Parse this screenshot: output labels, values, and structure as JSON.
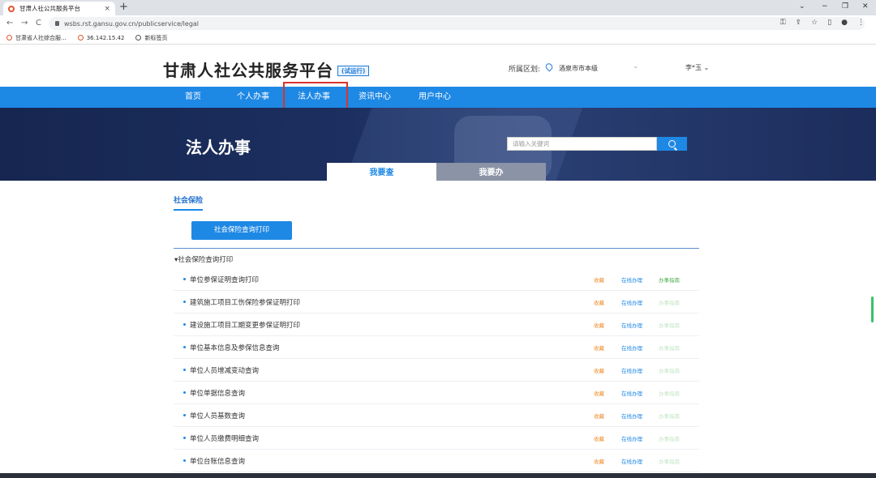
{
  "browser": {
    "tab_title": "甘肃人社公共服务平台",
    "tab_close": "×",
    "new_tab": "+",
    "window_controls": [
      "⌄",
      "−",
      "❐",
      "✕"
    ],
    "url": "wsbs.rst.gansu.gov.cn/publicservice/legal",
    "back": "←",
    "forward": "→",
    "reload": "C",
    "omni_icons": [
      "⚿",
      "⇪",
      "☆",
      "▯",
      "●",
      "⋮"
    ],
    "bookmarks": [
      "甘肃省人社综合服...",
      "36.142.15.42",
      "新标签页"
    ]
  },
  "header": {
    "title": "甘肃人社公共服务平台",
    "trial_badge": "(试运行)",
    "region_label": "所属区划:",
    "region_value": "酒泉市市本级",
    "region_arrow": "⌄",
    "user_name": "李*玉 ⌄"
  },
  "nav": {
    "items": [
      "首页",
      "个人办事",
      "法人办事",
      "资讯中心",
      "用户中心"
    ],
    "active": "法人办事"
  },
  "banner": {
    "title": "法人办事",
    "search_placeholder": "请输入关键词",
    "tabs": [
      "我要查",
      "我要办"
    ]
  },
  "content": {
    "section_tab": "社会保险",
    "primary_button": "社会保险查询打印",
    "group_title": "▾社会保险查询打印",
    "row_actions": {
      "favorite": "收藏",
      "online": "在线办理",
      "guide": "办事指南"
    },
    "rows": [
      {
        "name": "单位参保证明查询打印"
      },
      {
        "name": "建筑施工项目工伤保险参保证明打印"
      },
      {
        "name": "建设施工项目工期变更参保证明打印"
      },
      {
        "name": "单位基本信息及参保信息查询"
      },
      {
        "name": "单位人员增减变动查询"
      },
      {
        "name": "单位单据信息查询"
      },
      {
        "name": "单位人员基数查询"
      },
      {
        "name": "单位人员缴费明细查询"
      },
      {
        "name": "单位台账信息查询"
      }
    ]
  }
}
